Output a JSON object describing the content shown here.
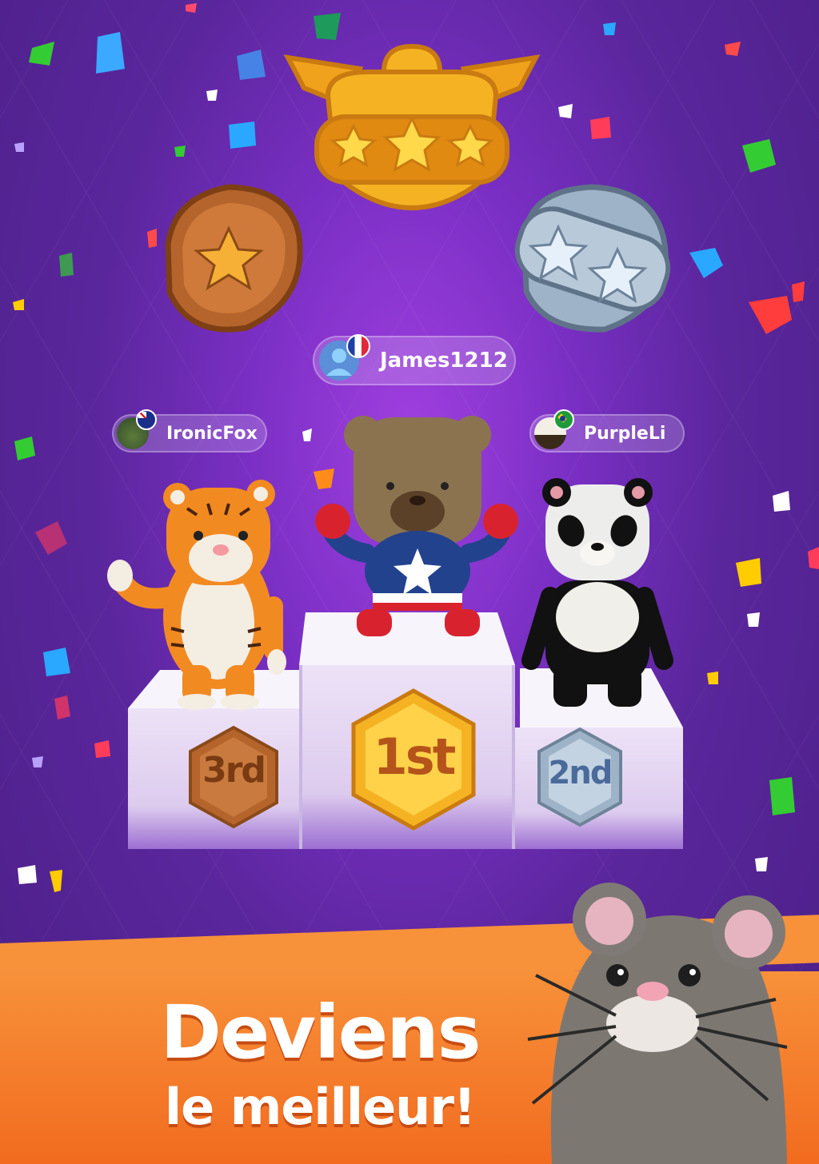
{
  "players": {
    "first": {
      "name": "James1212",
      "flag": "France"
    },
    "third": {
      "name": "IronicFox",
      "flag": "Australia"
    },
    "second": {
      "name": "PurpleLi",
      "flag": "Brazil"
    }
  },
  "podium": {
    "first_label": "1st",
    "second_label": "2nd",
    "third_label": "3rd"
  },
  "badges": {
    "gold_stars": 3,
    "silver_stars": 2,
    "bronze_stars": 1
  },
  "headline": {
    "line1": "Deviens",
    "line2": "le meilleur!"
  },
  "colors": {
    "background": "#6a2bb5",
    "gold": "#f5b324",
    "silver": "#9fb3c8",
    "bronze": "#b5642c",
    "banner": "#f47b25"
  }
}
